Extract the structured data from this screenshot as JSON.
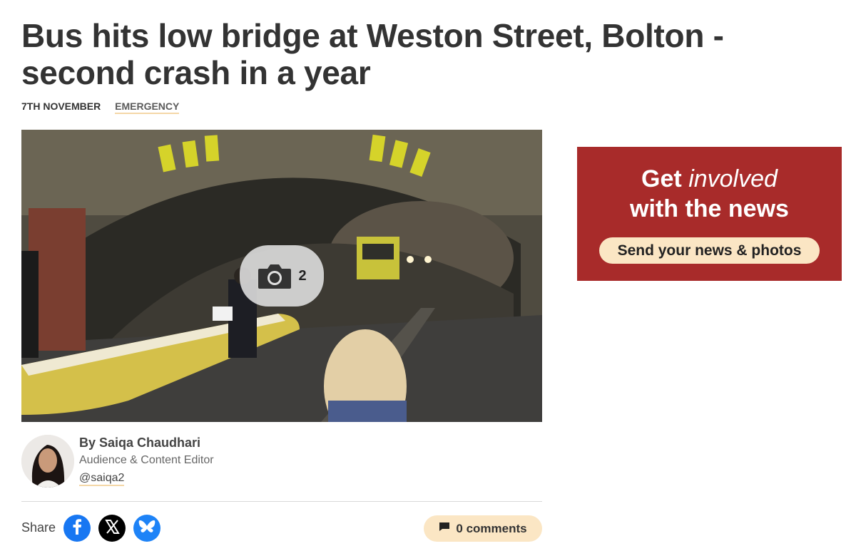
{
  "article": {
    "headline": "Bus hits low bridge at Weston Street, Bolton - second crash in a year",
    "date": "7TH NOVEMBER",
    "category": "EMERGENCY"
  },
  "gallery": {
    "icon": "camera-icon",
    "count": "2"
  },
  "author": {
    "name": "By Saiqa Chaudhari",
    "role": "Audience & Content Editor",
    "handle": "@saiqa2"
  },
  "share": {
    "label": "Share",
    "icons": [
      "facebook-icon",
      "x-icon",
      "bluesky-icon"
    ]
  },
  "comments": {
    "icon": "comment-icon",
    "label": "0 comments"
  },
  "promo": {
    "get": "Get",
    "involved": "involved",
    "line2": "with the news",
    "button": "Send your news & photos"
  },
  "colors": {
    "promo_bg": "#a82b2a",
    "accent_cream": "#fbe6c4",
    "facebook": "#1877f2",
    "bluesky": "#1e83f7"
  }
}
